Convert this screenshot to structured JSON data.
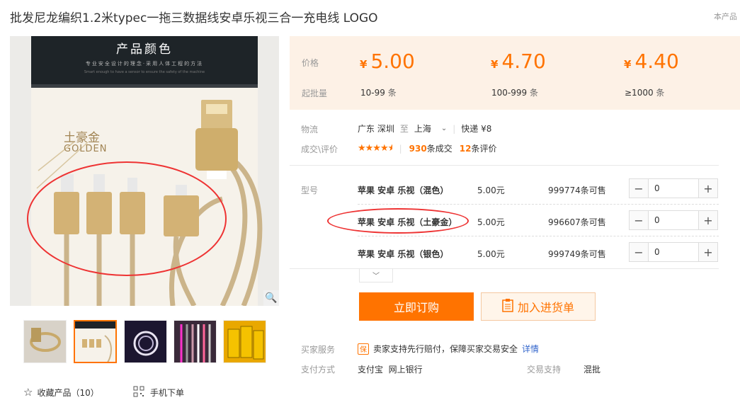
{
  "title": "批发尼龙编织1.2米typec一拖三数据线安卓乐视三合一充电线 LOGO",
  "ext_link": "本产品",
  "image": {
    "heading": "产品颜色",
    "sub": "专业安全设计的理念·采用人体工程的方法",
    "sub2": "Smart enough to have a sensor to ensure the safety of the machine",
    "color_cn": "土豪金",
    "color_en": "GOLDEN"
  },
  "favorite": {
    "label": "收藏产品（10）"
  },
  "mobile_order": {
    "label": "手机下单"
  },
  "price_section": {
    "price_label": "价格",
    "moq_label": "起批量",
    "tiers": [
      {
        "currency": "¥",
        "price": "5.00",
        "range": "10-99",
        "unit": "条"
      },
      {
        "currency": "¥",
        "price": "4.70",
        "range": "100-999",
        "unit": "条"
      },
      {
        "currency": "¥",
        "price": "4.40",
        "range": "≥1000",
        "unit": "条"
      }
    ]
  },
  "logistics": {
    "label": "物流",
    "from": "广东 深圳",
    "to_word": "至",
    "to": "上海",
    "shipping": "快递 ¥8"
  },
  "reviews": {
    "label": "成交\\评价",
    "rating": 4.5,
    "deals_num": "930",
    "deals_text": "条成交",
    "reviews_num": "12",
    "reviews_text": "条评价"
  },
  "sku": {
    "label": "型号",
    "rows": [
      {
        "name": "苹果 安卓 乐视（混色）",
        "price": "5.00元",
        "stock": "999774条可售",
        "qty": "0"
      },
      {
        "name": "苹果 安卓 乐视（土豪金）",
        "price": "5.00元",
        "stock": "996607条可售",
        "qty": "0"
      },
      {
        "name": "苹果 安卓 乐视（银色）",
        "price": "5.00元",
        "stock": "999749条可售",
        "qty": "0"
      }
    ]
  },
  "actions": {
    "buy": "立即订购",
    "cart": "加入进货单"
  },
  "service": {
    "label": "买家服务",
    "badge": "保",
    "text": "卖家支持先行赔付，保障买家交易安全",
    "detail": "详情"
  },
  "payment": {
    "label": "支付方式",
    "methods": "支付宝  网上银行",
    "trade_label": "交易支持",
    "trade_value": "混批"
  },
  "colors": {
    "accent": "#ff7300",
    "annotation": "#e33333",
    "price_bg": "#fdf1e6"
  }
}
